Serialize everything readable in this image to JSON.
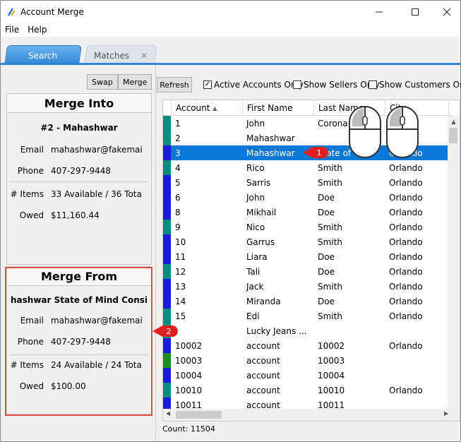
{
  "window": {
    "title": "Account Merge"
  },
  "menu": {
    "file": "File",
    "help": "Help"
  },
  "tabs": {
    "search": "Search",
    "matches": "Matches",
    "close": "✕"
  },
  "left": {
    "swap": "Swap",
    "merge": "Merge",
    "into": {
      "header": "Merge Into",
      "name": "#2 - Mahashwar",
      "email_label": "Email",
      "email": "mahashwar@fakemai",
      "phone_label": "Phone",
      "phone": "407-297-9448",
      "items_label": "# Items",
      "items": "33 Available / 36 Tota",
      "owed_label": "Owed",
      "owed": "$11,160.44"
    },
    "from": {
      "header": "Merge From",
      "name": "hashwar State of Mind Consi",
      "email_label": "Email",
      "email": "mahashwar@fakemai",
      "phone_label": "Phone",
      "phone": "407-297-9448",
      "items_label": "# Items",
      "items": "24 Available / 24 Tota",
      "owed_label": "Owed",
      "owed": "$100.00"
    }
  },
  "toolbar": {
    "refresh": "Refresh",
    "active_only": "Active Accounts Only",
    "sellers_only": "Show Sellers Only",
    "customers_only": "Show Customers Only",
    "active_checked": "✓"
  },
  "table": {
    "headers": {
      "account": "Account",
      "first": "First Name",
      "last": "Last Name",
      "city": "City"
    },
    "sort_arrow": "▲",
    "rows": [
      {
        "c": "#0a8f7f",
        "account": "1",
        "first": "John",
        "last": "Corona",
        "city": ""
      },
      {
        "c": "#0a8f7f",
        "account": "2",
        "first": "Mahashwar",
        "last": "",
        "city": ""
      },
      {
        "c": "#1a1adc",
        "account": "3",
        "first": "Mahashwar",
        "last": "State of",
        "city": "Orlando"
      },
      {
        "c": "#0a8f7f",
        "account": "4",
        "first": "Rico",
        "last": "Smith",
        "city": "Orlando"
      },
      {
        "c": "#1a1adc",
        "account": "5",
        "first": "Sarris",
        "last": "Smith",
        "city": "Orlando"
      },
      {
        "c": "#1a1adc",
        "account": "6",
        "first": "John",
        "last": "Doe",
        "city": "Orlando"
      },
      {
        "c": "#1a1adc",
        "account": "8",
        "first": "Mikhail",
        "last": "Doe",
        "city": "Orlando"
      },
      {
        "c": "#0a8f7f",
        "account": "9",
        "first": "Nico",
        "last": "Smith",
        "city": "Orlando"
      },
      {
        "c": "#1a1adc",
        "account": "10",
        "first": "Garrus",
        "last": "Smith",
        "city": "Orlando"
      },
      {
        "c": "#1a1adc",
        "account": "11",
        "first": "Liara",
        "last": "Doe",
        "city": "Orlando"
      },
      {
        "c": "#0a8f7f",
        "account": "12",
        "first": "Tali",
        "last": "Doe",
        "city": "Orlando"
      },
      {
        "c": "#1a1adc",
        "account": "13",
        "first": "Jack",
        "last": "Smith",
        "city": "Orlando"
      },
      {
        "c": "#1a1adc",
        "account": "14",
        "first": "Miranda",
        "last": "Doe",
        "city": "Orlando"
      },
      {
        "c": "#0a8f7f",
        "account": "15",
        "first": "Edi",
        "last": "Smith",
        "city": "Orlando"
      },
      {
        "c": "#0a8f7f",
        "account": "",
        "first": "Lucky Jeans ...",
        "last": "",
        "city": ""
      },
      {
        "c": "#1a1adc",
        "account": "10002",
        "first": "account",
        "last": "10002",
        "city": "Orlando"
      },
      {
        "c": "#1a8f1a",
        "account": "10003",
        "first": "account",
        "last": "10003",
        "city": ""
      },
      {
        "c": "#1a1adc",
        "account": "10004",
        "first": "account",
        "last": "10004",
        "city": ""
      },
      {
        "c": "#0a8f7f",
        "account": "10010",
        "first": "account",
        "last": "10010",
        "city": "Orlando"
      },
      {
        "c": "#1a1adc",
        "account": "10011",
        "first": "account",
        "last": "10011",
        "city": ""
      }
    ],
    "selected_index": 2
  },
  "status": {
    "count": "Count: 11504"
  },
  "callouts": {
    "one": "1",
    "two": "2"
  }
}
